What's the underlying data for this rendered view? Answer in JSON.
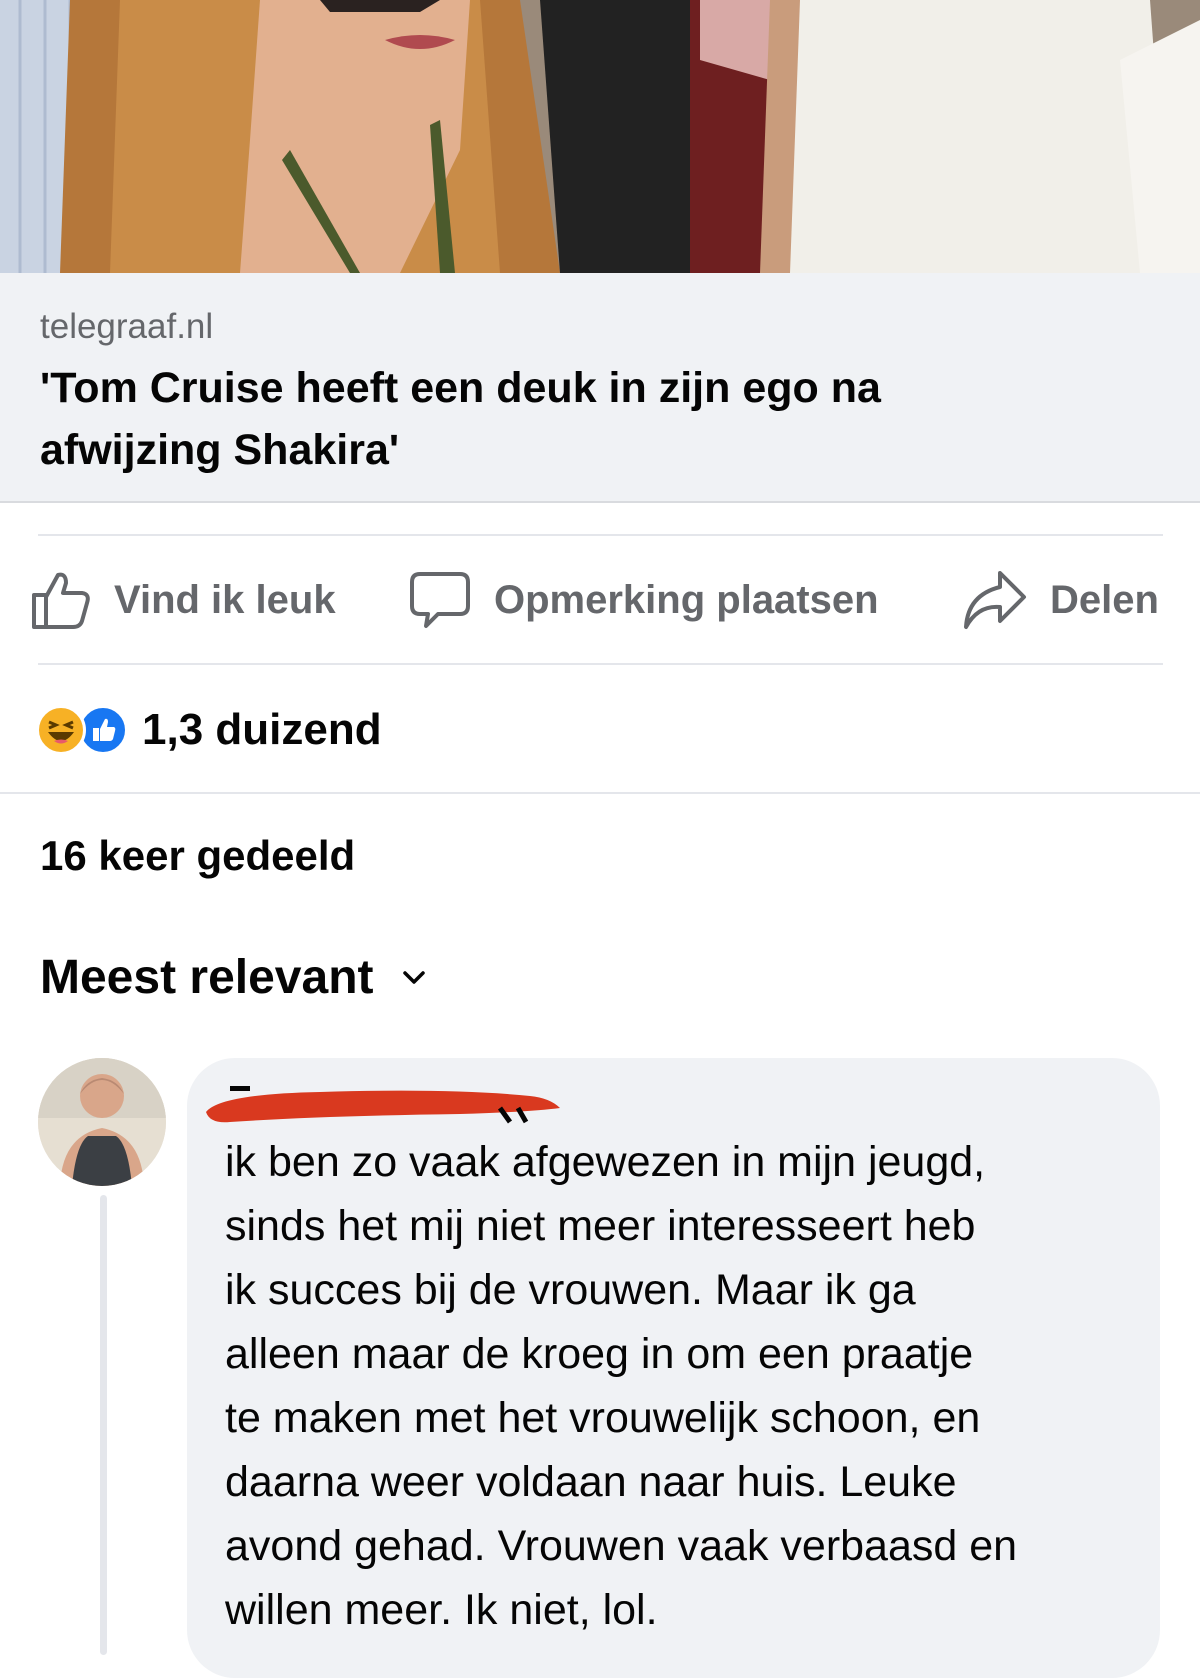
{
  "post": {
    "link_preview": {
      "domain": "telegraaf.nl",
      "title_lines": [
        "'Tom Cruise heeft een deuk in zijn ego na",
        "afwijzing Shakira'"
      ]
    },
    "actions": {
      "like_label": "Vind ik leuk",
      "comment_label": "Opmerking plaatsen",
      "share_label": "Delen"
    },
    "reactions": {
      "icons": [
        "haha-icon",
        "like-icon"
      ],
      "count": "1,3 duizend"
    },
    "shares_text": "16 keer gedeeld",
    "sort_label": "Meest relevant"
  },
  "comment": {
    "text_lines": [
      "ik ben zo vaak afgewezen in mijn jeugd,",
      "sinds het mij niet meer interesseert heb",
      "ik succes bij de vrouwen. Maar ik ga",
      "alleen maar de kroeg in om een praatje",
      "te maken met het vrouwelijk schoon, en",
      "daarna weer voldaan naar huis. Leuke",
      "avond gehad. Vrouwen vaak verbaasd en",
      "willen meer. Ik niet, lol."
    ]
  },
  "colors": {
    "secondary_text": "#65676b",
    "card_bg": "#f0f2f5",
    "like_blue": "#1877f2",
    "haha_yellow": "#f7b125",
    "redaction_red": "#d9391f"
  }
}
